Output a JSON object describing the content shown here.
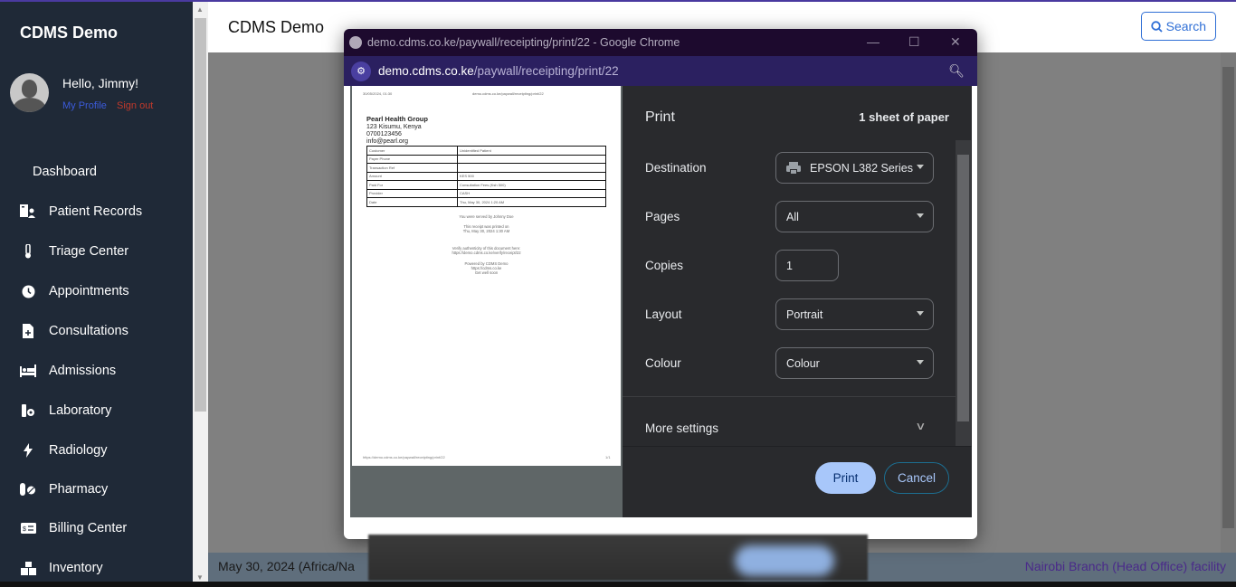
{
  "app": {
    "brand": "CDMS Demo",
    "page_title": "CDMS Demo",
    "search_label": "Search"
  },
  "user": {
    "greeting": "Hello, Jimmy!",
    "profile_link": "My Profile",
    "signout_link": "Sign out"
  },
  "sidebar": {
    "dashboard": "Dashboard",
    "items": [
      {
        "label": "Patient Records",
        "icon": "hospital-user-icon"
      },
      {
        "label": "Triage Center",
        "icon": "thermometer-icon"
      },
      {
        "label": "Appointments",
        "icon": "clock-icon"
      },
      {
        "label": "Consultations",
        "icon": "file-medical-icon"
      },
      {
        "label": "Admissions",
        "icon": "bed-icon"
      },
      {
        "label": "Laboratory",
        "icon": "vial-gear-icon"
      },
      {
        "label": "Radiology",
        "icon": "bolt-icon"
      },
      {
        "label": "Pharmacy",
        "icon": "pills-icon"
      },
      {
        "label": "Billing Center",
        "icon": "money-check-icon"
      },
      {
        "label": "Inventory",
        "icon": "boxes-icon"
      }
    ]
  },
  "footer": {
    "date": "May 30, 2024 (Africa/Na",
    "facility": "Nairobi Branch (Head Office) facility"
  },
  "chrome": {
    "window_title": "demo.cdms.co.ke/paywall/receipting/print/22 - Google Chrome",
    "url_host": "demo.cdms.co.ke",
    "url_path": "/paywall/receipting/print/22"
  },
  "print_preview": {
    "header_date": "30/05/2024, 01:30",
    "header_url": "demo.cdms.co.ke/paywall/receipting/print/22",
    "org_name": "Pearl Health Group",
    "org_address": "123 Kisumu, Kenya",
    "org_phone": "0700123456",
    "org_email": "info@pearl.org",
    "rows": [
      {
        "label": "Customer",
        "value": "Unidentified Patient"
      },
      {
        "label": "Payer Phone",
        "value": ""
      },
      {
        "label": "Transaction Ref",
        "value": ""
      },
      {
        "label": "Amount",
        "value": "KES 500"
      },
      {
        "label": "Paid For",
        "value": "Consultation Fees (Ksh 500)"
      },
      {
        "label": "Provider",
        "value": "CASH"
      },
      {
        "label": "Date",
        "value": "Thu, May 30, 2024 1:20 AM"
      }
    ],
    "served_by": "You were served by Johnny Doe",
    "printed_on_label": "This receipt was printed on",
    "printed_on": "Thu, May 30, 2024 1:30 AM",
    "verify_label": "Verify authenticity of this document here:",
    "verify_url": "https://demo.cdms.co.ke/verify/receipt/22",
    "powered_by": "Powered by CDMS Demo",
    "powered_url": "https://cdms.co.ke",
    "tagline": "Get well soon",
    "footer_url": "https://demo.cdms.co.ke/paywall/receipting/print/22",
    "page_count": "1/1"
  },
  "print_settings": {
    "title": "Print",
    "sheets": "1 sheet of paper",
    "destination_label": "Destination",
    "destination_value": "EPSON L382 Series",
    "pages_label": "Pages",
    "pages_value": "All",
    "copies_label": "Copies",
    "copies_value": "1",
    "layout_label": "Layout",
    "layout_value": "Portrait",
    "colour_label": "Colour",
    "colour_value": "Colour",
    "more_settings": "More settings",
    "print_button": "Print",
    "cancel_button": "Cancel"
  }
}
